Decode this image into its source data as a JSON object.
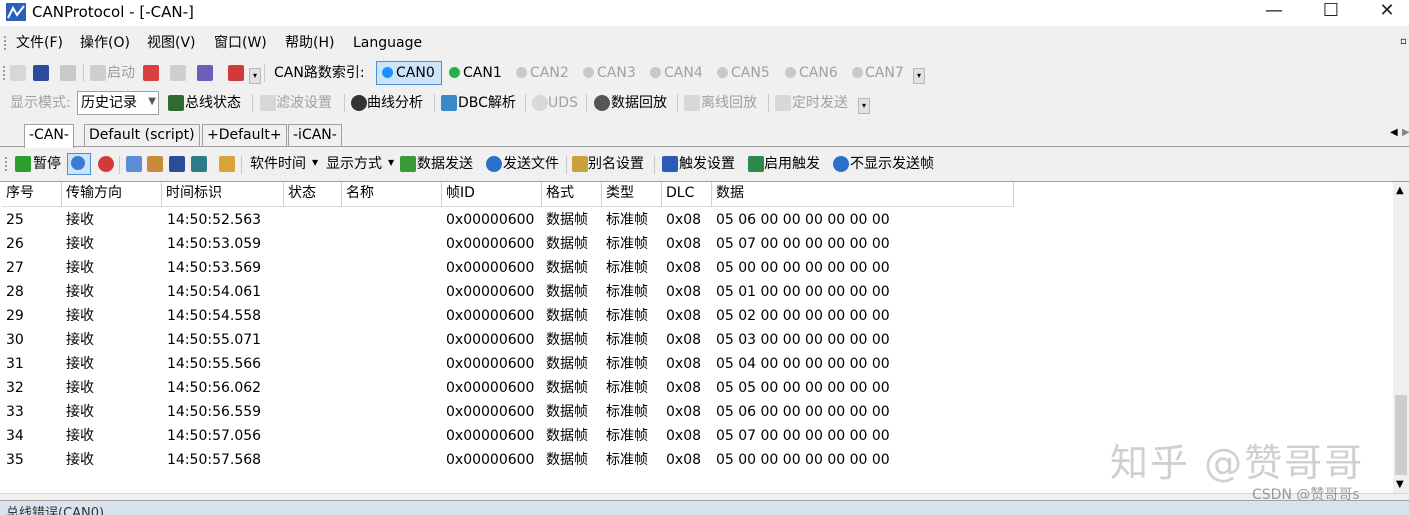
{
  "window": {
    "title": "CANProtocol - [-CAN-]",
    "minimize": "—",
    "maximize": "☐",
    "close": "✕"
  },
  "menu": [
    "文件(F)",
    "操作(O)",
    "视图(V)",
    "窗口(W)",
    "帮助(H)",
    "Language"
  ],
  "toolbar1": {
    "start": "启动",
    "can_index_label": "CAN路数索引:",
    "channels": [
      {
        "label": "CAN0",
        "enabled": true,
        "selected": true,
        "color": "#1e90ff"
      },
      {
        "label": "CAN1",
        "enabled": true,
        "selected": false,
        "color": "#22b14c"
      },
      {
        "label": "CAN2",
        "enabled": false,
        "selected": false,
        "color": "#c8c8c8"
      },
      {
        "label": "CAN3",
        "enabled": false,
        "selected": false,
        "color": "#c8c8c8"
      },
      {
        "label": "CAN4",
        "enabled": false,
        "selected": false,
        "color": "#c8c8c8"
      },
      {
        "label": "CAN5",
        "enabled": false,
        "selected": false,
        "color": "#c8c8c8"
      },
      {
        "label": "CAN6",
        "enabled": false,
        "selected": false,
        "color": "#c8c8c8"
      },
      {
        "label": "CAN7",
        "enabled": false,
        "selected": false,
        "color": "#c8c8c8"
      }
    ]
  },
  "toolbar2": {
    "display_mode_label": "显示模式:",
    "display_mode_value": "历史记录",
    "bus_status": "总线状态",
    "filter_settings": "滤波设置",
    "curve_analysis": "曲线分析",
    "dbc_parse": "DBC解析",
    "uds": "UDS",
    "data_playback": "数据回放",
    "offline_playback": "离线回放",
    "timed_send": "定时发送"
  },
  "tabs": [
    "-CAN-",
    "Default (script)",
    "+Default+",
    "-iCAN-"
  ],
  "toolbar3": {
    "pause": "暂停",
    "software_time": "软件时间",
    "display_format": "显示方式",
    "data_send": "数据发送",
    "send_file": "发送文件",
    "alias_settings": "别名设置",
    "trigger_settings": "触发设置",
    "enable_trigger": "启用触发",
    "hide_sent_frames": "不显示发送帧"
  },
  "grid": {
    "columns": [
      "序号",
      "传输方向",
      "时间标识",
      "状态",
      "名称",
      "帧ID",
      "格式",
      "类型",
      "DLC",
      "数据"
    ],
    "rows": [
      [
        "25",
        "接收",
        "14:50:52.563",
        "",
        "",
        "0x00000600",
        "数据帧",
        "标准帧",
        "0x08",
        "05 06 00 00 00 00 00 00"
      ],
      [
        "26",
        "接收",
        "14:50:53.059",
        "",
        "",
        "0x00000600",
        "数据帧",
        "标准帧",
        "0x08",
        "05 07 00 00 00 00 00 00"
      ],
      [
        "27",
        "接收",
        "14:50:53.569",
        "",
        "",
        "0x00000600",
        "数据帧",
        "标准帧",
        "0x08",
        "05 00 00 00 00 00 00 00"
      ],
      [
        "28",
        "接收",
        "14:50:54.061",
        "",
        "",
        "0x00000600",
        "数据帧",
        "标准帧",
        "0x08",
        "05 01 00 00 00 00 00 00"
      ],
      [
        "29",
        "接收",
        "14:50:54.558",
        "",
        "",
        "0x00000600",
        "数据帧",
        "标准帧",
        "0x08",
        "05 02 00 00 00 00 00 00"
      ],
      [
        "30",
        "接收",
        "14:50:55.071",
        "",
        "",
        "0x00000600",
        "数据帧",
        "标准帧",
        "0x08",
        "05 03 00 00 00 00 00 00"
      ],
      [
        "31",
        "接收",
        "14:50:55.566",
        "",
        "",
        "0x00000600",
        "数据帧",
        "标准帧",
        "0x08",
        "05 04 00 00 00 00 00 00"
      ],
      [
        "32",
        "接收",
        "14:50:56.062",
        "",
        "",
        "0x00000600",
        "数据帧",
        "标准帧",
        "0x08",
        "05 05 00 00 00 00 00 00"
      ],
      [
        "33",
        "接收",
        "14:50:56.559",
        "",
        "",
        "0x00000600",
        "数据帧",
        "标准帧",
        "0x08",
        "05 06 00 00 00 00 00 00"
      ],
      [
        "34",
        "接收",
        "14:50:57.056",
        "",
        "",
        "0x00000600",
        "数据帧",
        "标准帧",
        "0x08",
        "05 07 00 00 00 00 00 00"
      ],
      [
        "35",
        "接收",
        "14:50:57.568",
        "",
        "",
        "0x00000600",
        "数据帧",
        "标准帧",
        "0x08",
        "05 00 00 00 00 00 00 00"
      ]
    ]
  },
  "status": "总线错误(CAN0)",
  "watermark": {
    "main": "知乎 @赞哥哥",
    "csdn": "CSDN @赞哥哥s"
  }
}
